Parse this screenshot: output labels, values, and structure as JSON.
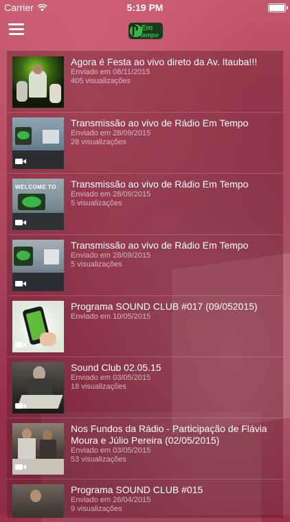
{
  "status": {
    "carrier": "Carrier",
    "time": "5:19 PM"
  },
  "navbar": {
    "logo_text": "Em tempo"
  },
  "videos": [
    {
      "title": "Agora é Festa ao vivo direto da Av. Itauba!!!",
      "date": "Enviado em 08/11/2015",
      "views": "405 visualizações"
    },
    {
      "title": "Transmissão ao vivo de Rádio Em Tempo",
      "date": "Enviado em 28/09/2015",
      "views": "28 visualizações"
    },
    {
      "title": "Transmissão ao vivo de Rádio Em Tempo",
      "date": "Enviado em 28/09/2015",
      "views": "5 visualizações"
    },
    {
      "title": "Transmissão ao vivo de Rádio Em Tempo",
      "date": "Enviado em 28/09/2015",
      "views": "5 visualizações"
    },
    {
      "title": "Programa SOUND CLUB #017 (09/052015)",
      "date": "Enviado em 10/05/2015",
      "views": ""
    },
    {
      "title": "Sound Club 02.05.15",
      "date": "Enviado em 03/05/2015",
      "views": "18 visualizações"
    },
    {
      "title": "Nos Fundos da Rádio - Participação de Flávia Moura e Júlio Pereira (02/05/2015)",
      "date": "Enviado em 03/05/2015",
      "views": "53 visualizações"
    },
    {
      "title": "Programa SOUND CLUB #015",
      "date": "Enviado em 26/04/2015",
      "views": "9 visualizações"
    }
  ],
  "thumb_text": {
    "welcome": "WELCOME TO"
  }
}
